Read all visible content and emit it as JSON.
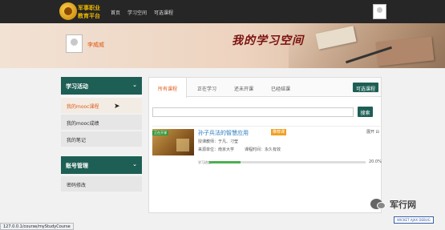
{
  "header": {
    "logo_line1": "军事职业",
    "logo_line2": "教育平台",
    "nav": [
      "首页",
      "学习空间",
      "可选课程"
    ]
  },
  "banner": {
    "username": "李威威",
    "title": "我的学习空间"
  },
  "sidebar": {
    "section1_title": "学习活动",
    "section1_items": [
      "我的mooc课程",
      "我的mooc成绩",
      "我的笔记"
    ],
    "section2_title": "账号管理",
    "section2_items": [
      "密码修改"
    ]
  },
  "main": {
    "tabs": [
      "所有课程",
      "正在学习",
      "还未开课",
      "已经结课"
    ],
    "elective_button": "可选课程",
    "search_button": "搜索",
    "search_value": "",
    "course": {
      "thumb_badge": "正在开课",
      "title": "孙子兵法的智慧应用",
      "tag": "推荐课",
      "teacher": "授课教师：于凡、刁莹",
      "source": "来源单位：南京大学",
      "time": "课程时间：永久有效",
      "expand": "展开",
      "progress_label": "学习进度：",
      "progress_text": "20.0%",
      "progress_value": 0.2
    }
  },
  "statusbar": {
    "url": "127.0.0.1/course/myStudyCourse"
  },
  "watermark": {
    "text": "军行网"
  },
  "debug_badge": {
    "text": "WICKET AJAX DEBUG"
  },
  "colors": {
    "accent": "#e05a1a",
    "primary": "#1e5f55",
    "link": "#2a7bbd",
    "progress": "#4caf50"
  }
}
